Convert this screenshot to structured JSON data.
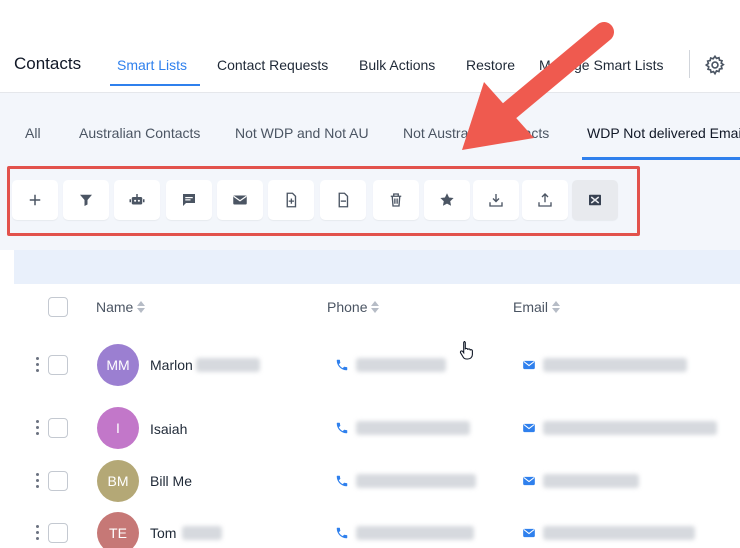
{
  "nav": {
    "title": "Contacts",
    "tabs": [
      {
        "label": "Smart Lists"
      },
      {
        "label": "Contact Requests"
      },
      {
        "label": "Bulk Actions"
      },
      {
        "label": "Restore"
      },
      {
        "label": "Manage Smart Lists"
      }
    ]
  },
  "lists": {
    "tabs": [
      {
        "label": "All"
      },
      {
        "label": "Australian Contacts"
      },
      {
        "label": "Not WDP and Not AU"
      },
      {
        "label": "Not Australian Contacts"
      },
      {
        "label": "WDP Not delivered Emails"
      }
    ]
  },
  "toolbar": {
    "buttons": [
      {
        "icon": "plus-icon"
      },
      {
        "icon": "filter-icon"
      },
      {
        "icon": "robot-icon"
      },
      {
        "icon": "message-icon"
      },
      {
        "icon": "email-icon"
      },
      {
        "icon": "tag-add-icon"
      },
      {
        "icon": "tag-remove-icon"
      },
      {
        "icon": "trash-icon"
      },
      {
        "icon": "star-icon"
      },
      {
        "icon": "import-icon"
      },
      {
        "icon": "export-icon"
      },
      {
        "icon": "merge-icon"
      }
    ]
  },
  "table": {
    "columns": {
      "name": "Name",
      "phone": "Phone",
      "email": "Email"
    },
    "rows": [
      {
        "initials": "MM",
        "name": "Marlon",
        "avatar_color": "#9b7fd1"
      },
      {
        "initials": "I",
        "name": "Isaiah",
        "avatar_color": "#c277c9"
      },
      {
        "initials": "BM",
        "name": "Bill Me",
        "avatar_color": "#b4a876"
      },
      {
        "initials": "TE",
        "name": "Tom",
        "avatar_color": "#c67876"
      }
    ]
  },
  "colors": {
    "accent": "#2f80ed",
    "highlight": "#e2524c",
    "arrow": "#ef5a4f"
  }
}
